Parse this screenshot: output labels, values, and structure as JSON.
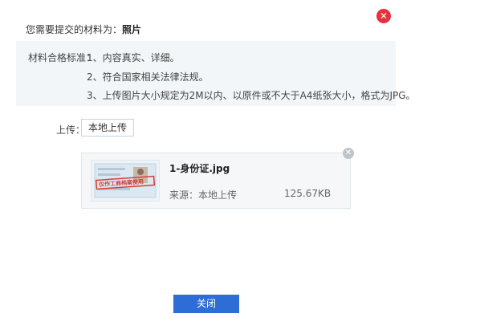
{
  "header": {
    "prefix": "您需要提交的材料为：",
    "material": "照片"
  },
  "criteria": {
    "label": "材料合格标准：",
    "items": [
      "1、内容真实、详细。",
      "2、符合国家相关法律法规。",
      "3、上传图片大小规定为2M以内、以原件或不大于A4纸张大小，格式为JPG。"
    ]
  },
  "upload": {
    "label": "上传：",
    "button": "本地上传"
  },
  "file": {
    "name": "1-身份证.jpg",
    "source": "来源：本地上传",
    "size": "125.67KB",
    "stamp": "仅作工商档案使用"
  },
  "footer": {
    "close_label": "关闭"
  },
  "colors": {
    "close_icon": "#e8313a",
    "primary_button": "#2d6dd6",
    "criteria_bg": "#f2f6f9"
  }
}
